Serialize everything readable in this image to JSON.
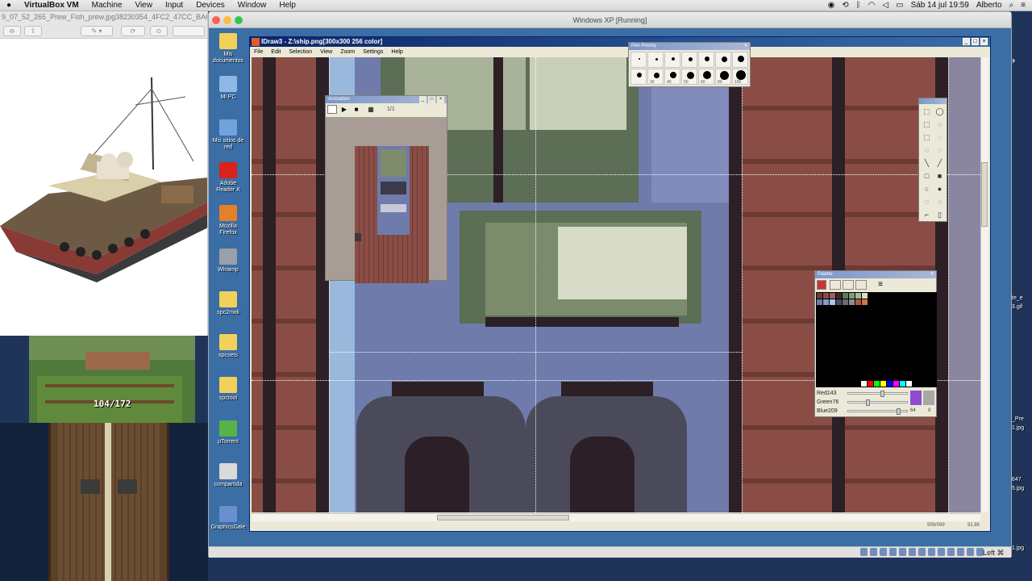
{
  "menubar": {
    "apple_glyph": "",
    "app_name": "VirtualBox VM",
    "items": [
      "Machine",
      "View",
      "Input",
      "Devices",
      "Window",
      "Help"
    ],
    "clock": "Sáb 14 jul  19:59",
    "user": "Alberto"
  },
  "preview": {
    "filename": "9_07_52_265_Prew_Fish_prew.jpg38230354_4FC2_47CC_BA6A_"
  },
  "game": {
    "counter": "104/172"
  },
  "vbox": {
    "title": "Windows XP [Running]",
    "status_key": "Left ⌘"
  },
  "desktop_icons": [
    {
      "label": "Mis documentos",
      "color": "#f2d15b"
    },
    {
      "label": "Mi PC",
      "color": "#8fb7e6"
    },
    {
      "label": "Mis sitios de red",
      "color": "#6fa3dc"
    },
    {
      "label": "Adobe Reader X",
      "color": "#d8221b"
    },
    {
      "label": "Mozilla Firefox",
      "color": "#e2812a"
    },
    {
      "label": "Winamp",
      "color": "#9aa0a8"
    },
    {
      "label": "spc2midi",
      "color": "#f2d15b"
    },
    {
      "label": "spcsets",
      "color": "#f2d15b"
    },
    {
      "label": "spctool",
      "color": "#f2d15b"
    },
    {
      "label": "µTorrent",
      "color": "#58b24a"
    },
    {
      "label": "compartida",
      "color": "#d9d9d9"
    },
    {
      "label": "GraphicsGale",
      "color": "#6a8fd0"
    }
  ],
  "idraw": {
    "title": "IDraw3 - Z:\\ship.png[300x300 256 color]",
    "menu": [
      "File",
      "Edit",
      "Selection",
      "View",
      "Zoom",
      "Settings",
      "Help"
    ],
    "status_left": "999/099",
    "status_right": "92,86"
  },
  "pen_priority": {
    "title": "Pen Priority",
    "sizes": [
      "30",
      "40",
      "50",
      "60",
      "80",
      "100"
    ]
  },
  "animation": {
    "title": "Animation",
    "frame": "1/1"
  },
  "palette": {
    "title": "Palette",
    "red_label": "Red",
    "red_value": "143",
    "green_label": "Green",
    "green_value": "76",
    "blue_label": "Blue",
    "blue_value": "209",
    "value_a": "64",
    "value_b": "0",
    "colors": [
      "#6b3a33",
      "#8a4d45",
      "#a0605a",
      "#3b2a2a",
      "#5e7a5a",
      "#7f9a78",
      "#aab79a",
      "#d8dcc8",
      "#6c79a6",
      "#8c98c4",
      "#a8c8e8",
      "#4a4a5a",
      "#6a6a7a",
      "#8a8a9a",
      "#b05a3a",
      "#c87a4a"
    ]
  },
  "host_right_labels": [
    "te_e",
    "3.gif",
    "_Pre",
    "1.jpg",
    "647",
    "5.jpg",
    "1.jpg"
  ]
}
